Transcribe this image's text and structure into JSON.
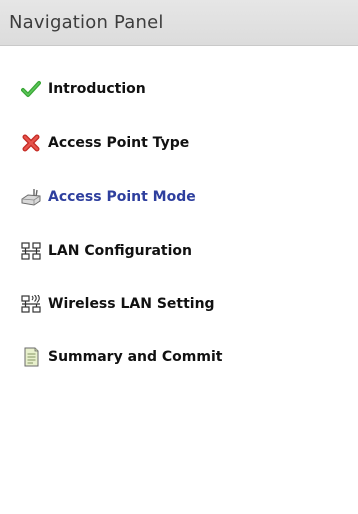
{
  "panel": {
    "title": "Navigation Panel"
  },
  "nav": {
    "items": [
      {
        "label": "Introduction",
        "icon": "check-icon",
        "status": "complete"
      },
      {
        "label": "Access Point Type",
        "icon": "error-x-icon",
        "status": "error"
      },
      {
        "label": "Access Point Mode",
        "icon": "access-point-device-icon",
        "status": "current"
      },
      {
        "label": "LAN Configuration",
        "icon": "network-lan-icon",
        "status": "pending"
      },
      {
        "label": "Wireless LAN Setting",
        "icon": "wireless-lan-icon",
        "status": "pending"
      },
      {
        "label": "Summary and Commit",
        "icon": "document-summary-icon",
        "status": "pending"
      }
    ]
  },
  "colors": {
    "header_bg": "#e0e0e0",
    "active_label": "#2e3f9e",
    "check_green": "#3aa637",
    "error_red": "#d8322b"
  }
}
